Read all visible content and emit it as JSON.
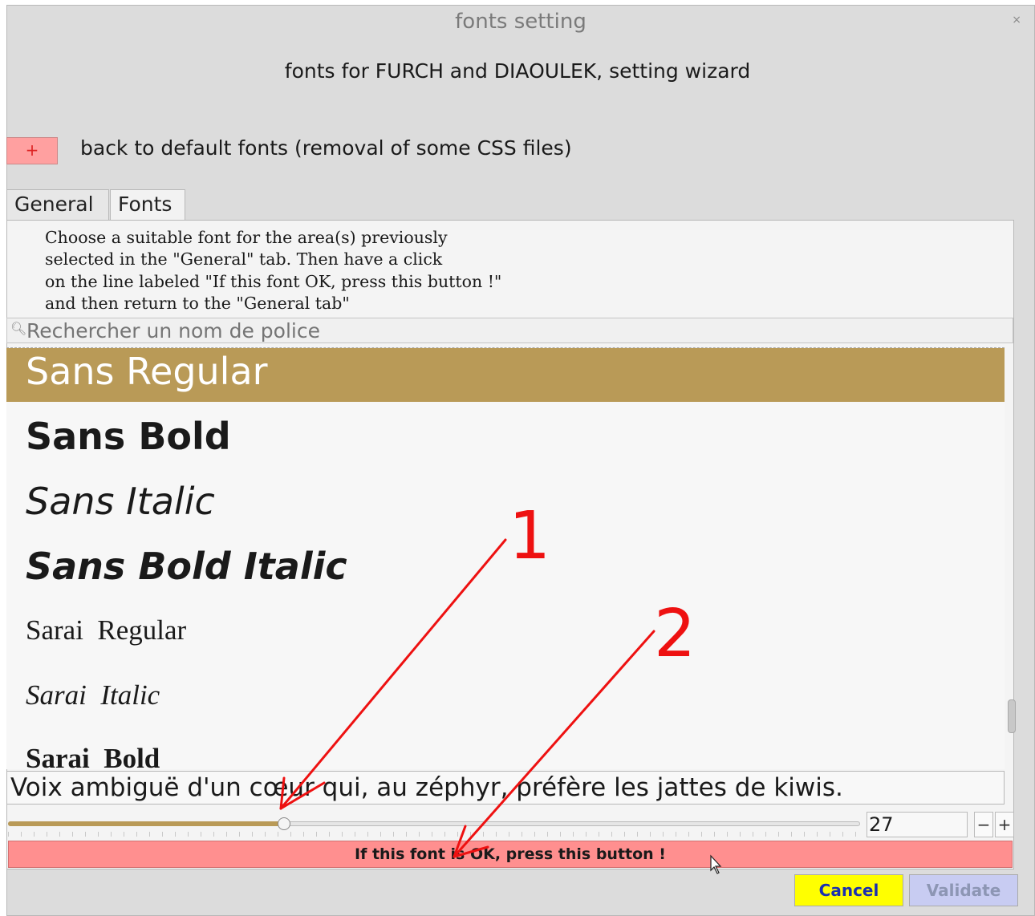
{
  "window": {
    "title": "fonts setting",
    "close_label": "×"
  },
  "header": {
    "subtitle": "fonts for FURCH and DIAOULEK, setting wizard"
  },
  "reset": {
    "button_label": "+",
    "label": "back to default fonts (removal of some CSS files)"
  },
  "tabs": [
    {
      "label": "General"
    },
    {
      "label": "Fonts"
    }
  ],
  "instructions": "Choose a suitable font for the area(s) previously\nselected in the \"General\" tab. Then have a click\non the line labeled \"If this font OK, press this button !\"\nand then return to the \"General tab\"",
  "search": {
    "placeholder": "Rechercher un nom de police",
    "value": ""
  },
  "font_list": [
    {
      "label": "Sans Regular",
      "selected": true
    },
    {
      "label": "Sans Bold"
    },
    {
      "label": "Sans Italic"
    },
    {
      "label": "Sans Bold Italic"
    },
    {
      "label": "Sarai  Regular"
    },
    {
      "label": "Sarai  Italic"
    },
    {
      "label": "Sarai  Bold"
    }
  ],
  "preview_text": "Voix ambiguë d'un cœur qui, au zéphyr, préfère les jattes de kiwis.",
  "size": {
    "value": "27",
    "minus": "−",
    "plus": "+"
  },
  "ok_button": "If this font is OK, press this button !",
  "footer": {
    "cancel": "Cancel",
    "validate": "Validate"
  },
  "annotations": [
    {
      "label": "1"
    },
    {
      "label": "2"
    }
  ],
  "colors": {
    "selection": "#b99a57",
    "ok_button": "#ff8f8f",
    "cancel_button": "#ffff00",
    "validate_button": "#c8ccf2",
    "annotation": "#ee1111"
  }
}
